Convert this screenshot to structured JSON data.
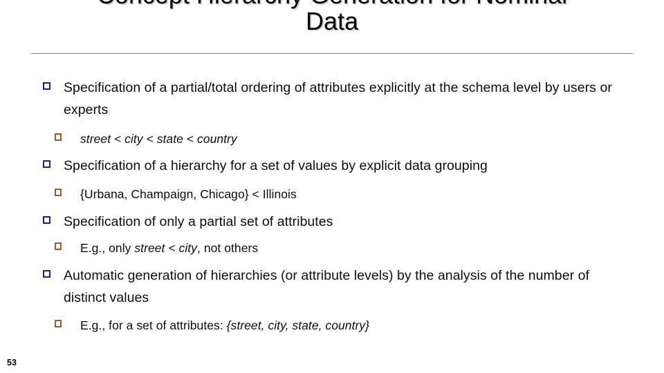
{
  "slide": {
    "title_lines": [
      "Concept Hierarchy Generation for Nominal",
      "Data"
    ],
    "slide_number": "53",
    "colors": {
      "background": "#ffffff",
      "text": "#0d0d0d",
      "title": "#000000",
      "rule": "#808080",
      "bullet_level1": "#1f1f8c",
      "bullet_level2": "#9c5a2e"
    },
    "bullets": [
      {
        "level": 1,
        "marker": "hollow-square-blue",
        "text": "Specification of a partial/total ordering of attributes explicitly at the schema level by users or experts"
      },
      {
        "level": 2,
        "marker": "hollow-square-brown",
        "text": "street < city < state < country",
        "italic_full": true
      },
      {
        "level": 1,
        "marker": "hollow-square-blue",
        "text": "Specification of a hierarchy for a set of values by explicit data grouping"
      },
      {
        "level": 2,
        "marker": "hollow-square-brown",
        "text": "{Urbana, Champaign, Chicago} < Illinois"
      },
      {
        "level": 1,
        "marker": "hollow-square-blue",
        "text": "Specification of only a partial set of attributes"
      },
      {
        "level": 2,
        "marker": "hollow-square-brown",
        "text_parts": {
          "pre": "E.g., only ",
          "italic": "street < city",
          "post": ", not others"
        }
      },
      {
        "level": 1,
        "marker": "hollow-square-blue",
        "text": "Automatic generation of hierarchies (or attribute levels) by the analysis of the number of distinct values"
      },
      {
        "level": 2,
        "marker": "hollow-square-brown",
        "text_parts": {
          "pre": "E.g., for a set of attributes: ",
          "italic": "{street, city, state, country}",
          "post": ""
        }
      }
    ]
  }
}
